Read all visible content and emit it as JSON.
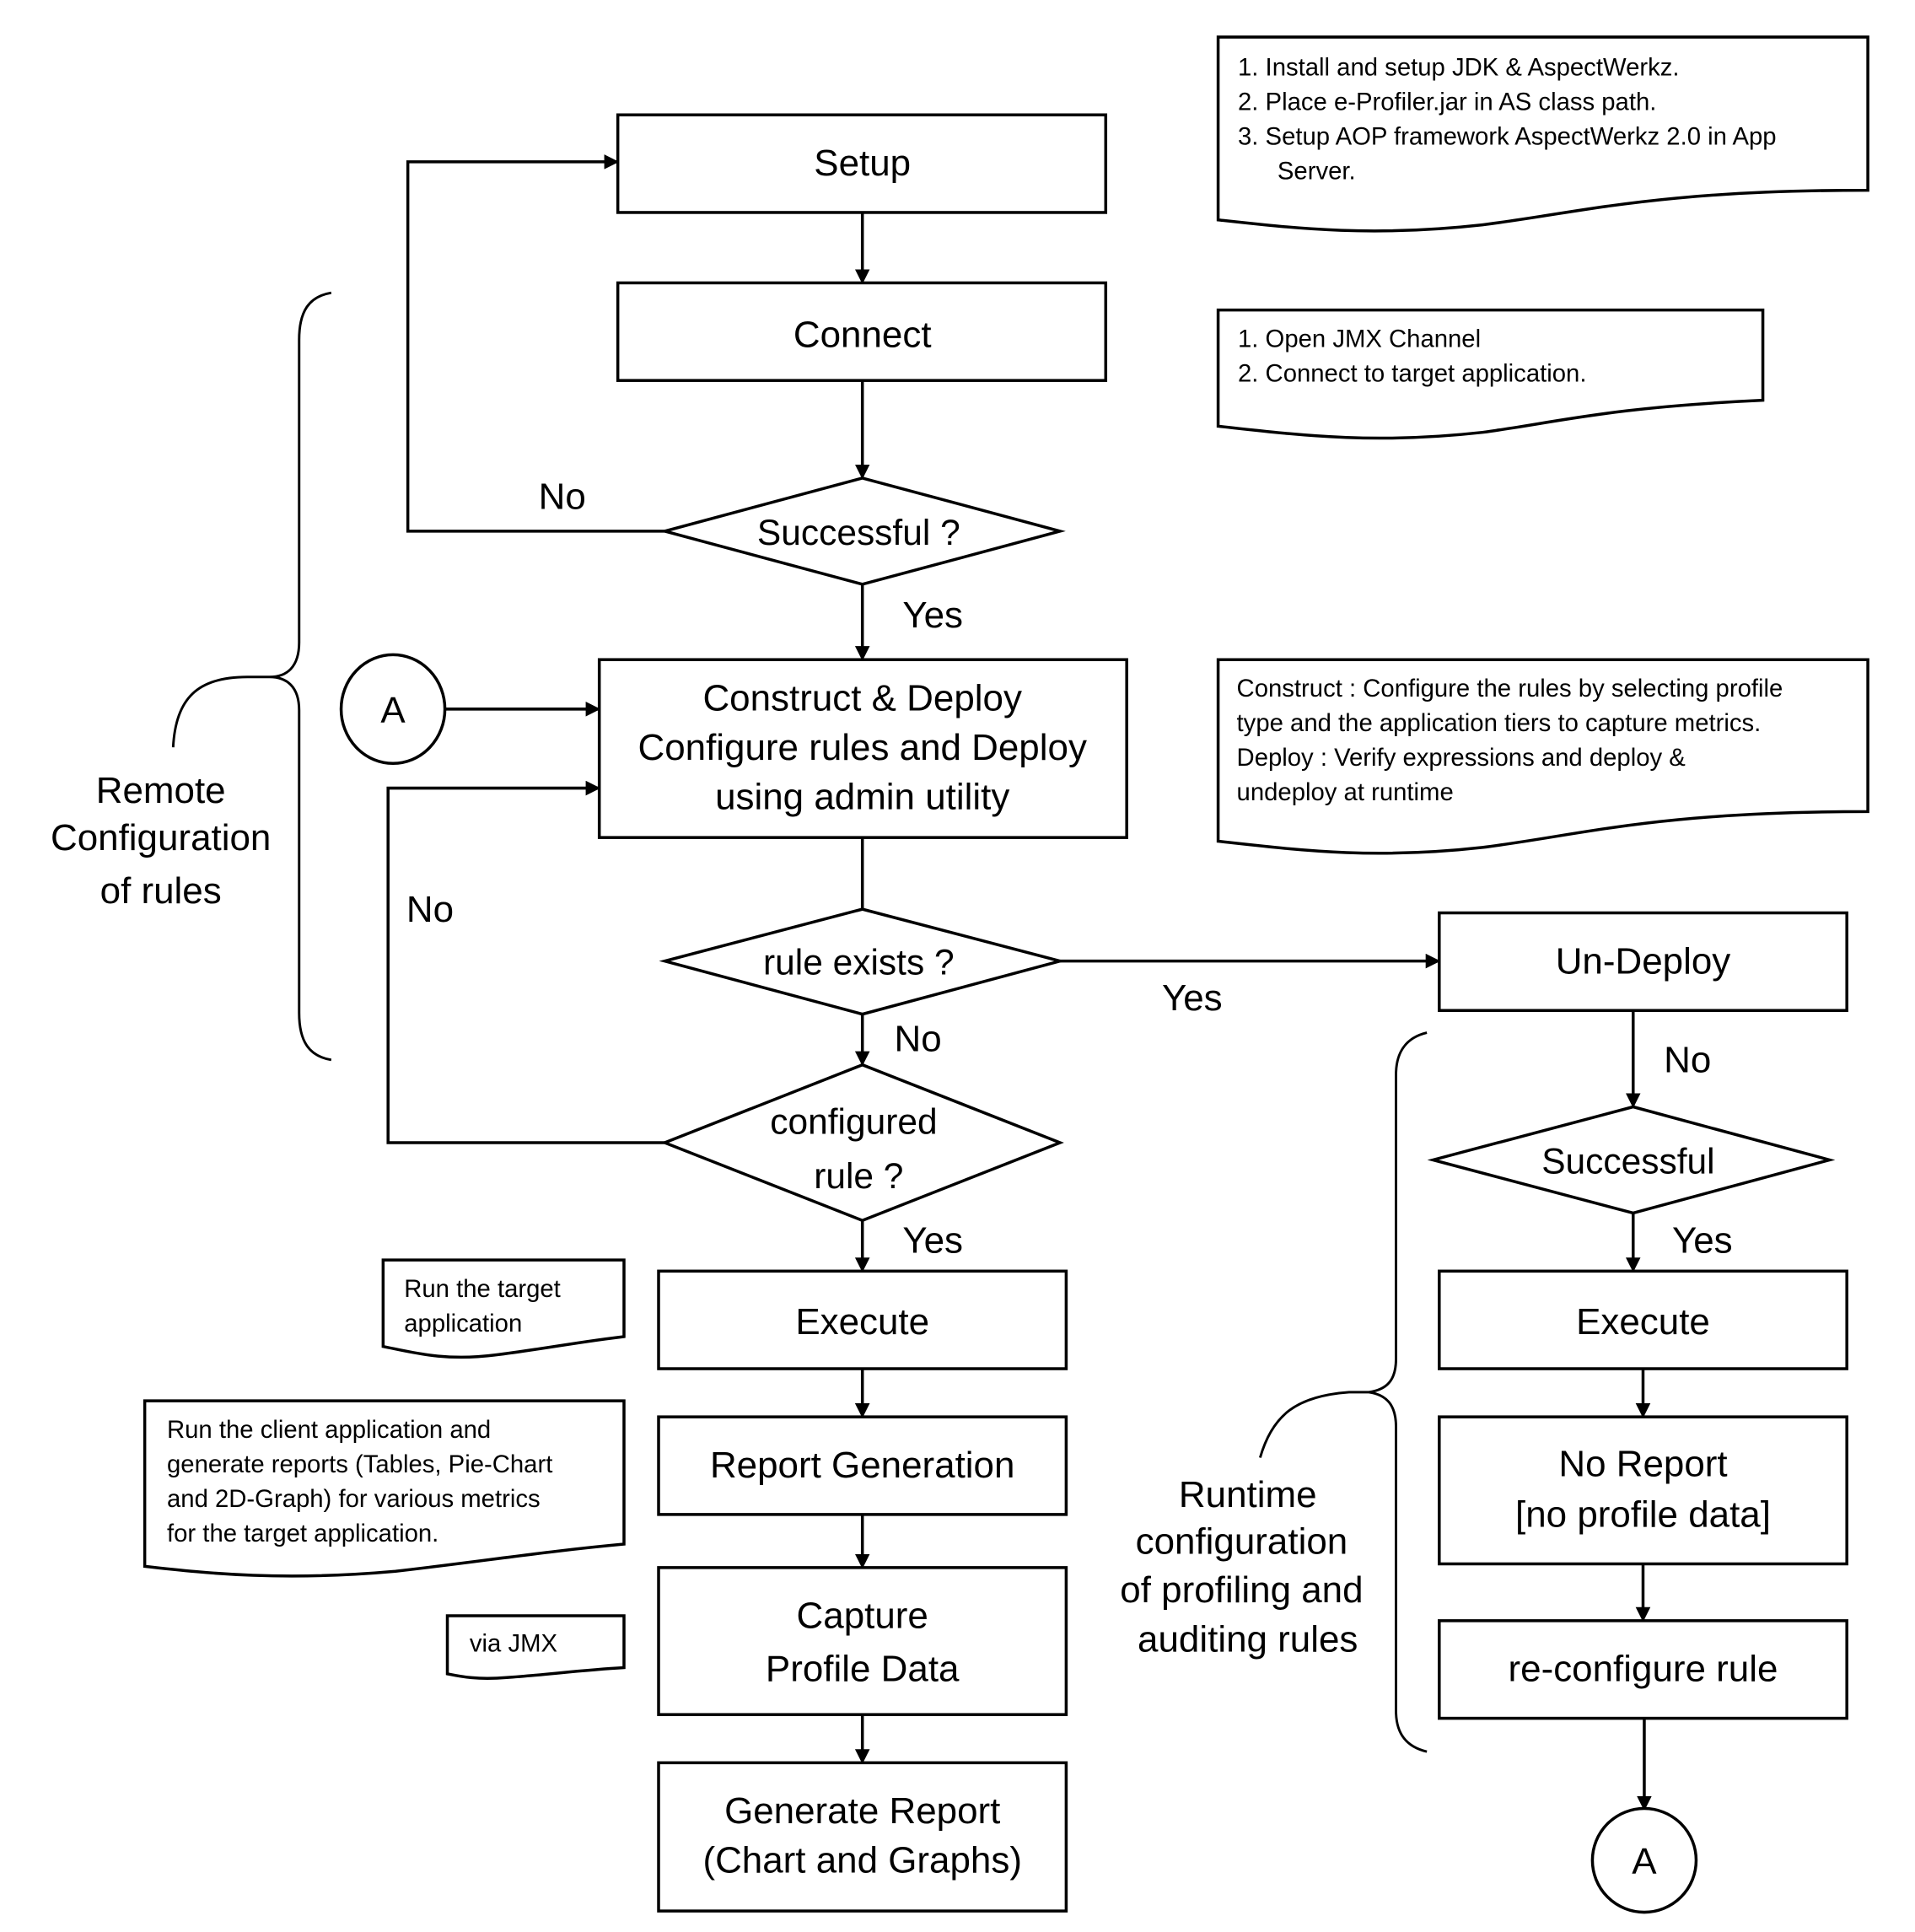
{
  "diagram": {
    "type": "flowchart",
    "stroke_color": "#000000",
    "background_color": "#ffffff"
  },
  "nodes": {
    "setup": "Setup",
    "connect": "Connect",
    "successful_q": "Successful ?",
    "construct": [
      "Construct & Deploy",
      "Configure rules and Deploy",
      "using admin utility"
    ],
    "rule_exists": "rule exists ?",
    "configured_rule": [
      "configured",
      "rule ?"
    ],
    "execute": "Execute",
    "report_generation": "Report Generation",
    "capture": [
      "Capture",
      "Profile Data"
    ],
    "generate_report": [
      "Generate Report",
      "(Chart and Graphs)"
    ],
    "undeploy": "Un-Deploy",
    "successful_right": "Successful",
    "execute_right": "Execute",
    "no_report": [
      "No Report",
      "[no profile data]"
    ],
    "reconfigure": "re-configure rule",
    "connector_left": "A",
    "connector_right": "A"
  },
  "edge_labels": {
    "no_setup": "No",
    "yes_successful": "Yes",
    "no_configured": "No",
    "yes_rule_exists": "Yes",
    "no_rule_exists": "No",
    "yes_configured": "Yes",
    "no_undeploy": "No",
    "yes_successful_right": "Yes"
  },
  "notes": {
    "setup_note": [
      "1.  Install and setup JDK & AspectWerkz.",
      "2.  Place e-Profiler.jar in AS class path.",
      "3.  Setup AOP framework AspectWerkz 2.0 in App",
      "     Server."
    ],
    "connect_note": [
      "1.  Open JMX Channel",
      "2.  Connect to target application."
    ],
    "construct_note": [
      "Construct : Configure the rules by selecting profile",
      "type and the application tiers to capture metrics.",
      "Deploy : Verify expressions and deploy &",
      "undeploy at runtime"
    ],
    "execute_note": [
      "Run the target",
      "application"
    ],
    "report_note": [
      "Run the client application and",
      "generate reports (Tables, Pie-Chart",
      "and 2D-Graph) for various metrics",
      "for the target application."
    ],
    "capture_note": [
      "via JMX"
    ]
  },
  "annotations": {
    "remote_config": [
      "Remote",
      "Configuration",
      "of rules"
    ],
    "runtime_config": [
      "Runtime",
      "configuration",
      "of profiling and",
      "auditing rules"
    ]
  }
}
